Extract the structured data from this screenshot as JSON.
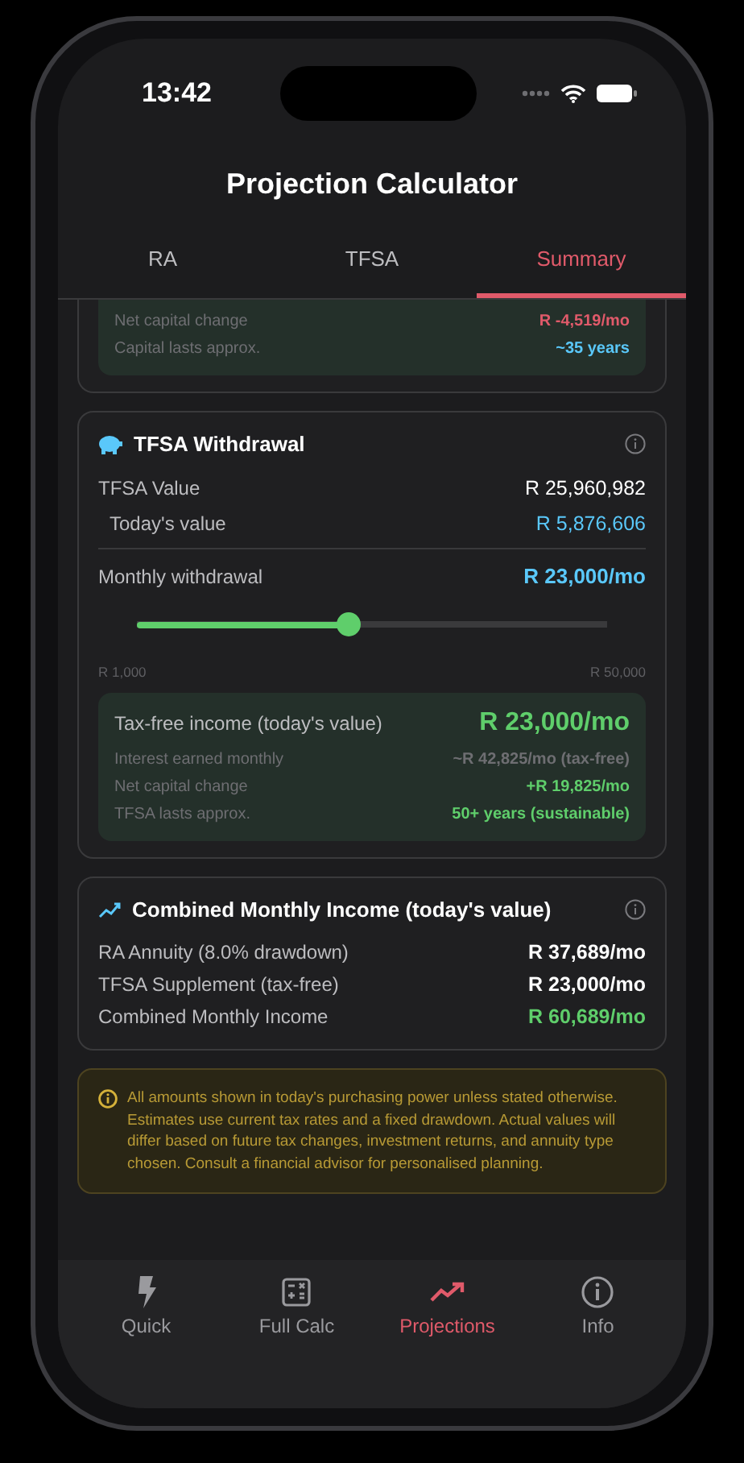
{
  "status_bar": {
    "time": "13:42"
  },
  "header": {
    "title": "Projection Calculator"
  },
  "tabs": [
    {
      "label": "RA",
      "selected": false
    },
    {
      "label": "TFSA",
      "selected": false
    },
    {
      "label": "Summary",
      "selected": true
    }
  ],
  "ra_summary_partial": {
    "rows": [
      {
        "label": "Net capital change",
        "value": "R -4,519/mo",
        "color": "#e05a6a"
      },
      {
        "label": "Capital lasts approx.",
        "value": "~35 years",
        "color": "#5ac8fa"
      }
    ]
  },
  "tfsa_card": {
    "title": "TFSA Withdrawal",
    "value_rows": [
      {
        "label": "TFSA Value",
        "value": "R 25,960,982",
        "color": "#ffffff",
        "indented": false
      },
      {
        "label": "Today's value",
        "value": "R 5,876,606",
        "color": "#5ac8fa",
        "indented": true
      }
    ],
    "withdrawal": {
      "label": "Monthly withdrawal",
      "value": "R 23,000/mo",
      "level": 0.45,
      "min_label": "R 1,000",
      "max_label": "R 50,000"
    },
    "result": {
      "label": "Tax-free income (today's value)",
      "value": "R 23,000/mo",
      "rows": [
        {
          "label": "Interest earned monthly",
          "value": "~R 42,825/mo (tax-free)",
          "color": "#6e6e72"
        },
        {
          "label": "Net capital change",
          "value": "+R 19,825/mo",
          "color": "#5fce6b"
        },
        {
          "label": "TFSA lasts approx.",
          "value": "50+ years (sustainable)",
          "color": "#5fce6b"
        }
      ]
    }
  },
  "combined_card": {
    "title": "Combined Monthly Income (today's value)",
    "rows": [
      {
        "label": "RA Annuity (8.0% drawdown)",
        "value": "R 37,689/mo",
        "color": "#ffffff"
      },
      {
        "label": "TFSA Supplement (tax-free)",
        "value": "R 23,000/mo",
        "color": "#ffffff"
      },
      {
        "label": "Combined Monthly Income",
        "value": "R 60,689/mo",
        "color": "#5fce6b"
      }
    ]
  },
  "notice": {
    "text": "All amounts shown in today's purchasing power unless stated otherwise. Estimates use current tax rates and a fixed drawdown. Actual values will differ based on future tax changes, investment returns, and annuity type chosen. Consult a financial advisor for personalised planning."
  },
  "bottom_nav": [
    {
      "label": "Quick",
      "selected": false
    },
    {
      "label": "Full Calc",
      "selected": false
    },
    {
      "label": "Projections",
      "selected": true
    },
    {
      "label": "Info",
      "selected": false
    }
  ]
}
